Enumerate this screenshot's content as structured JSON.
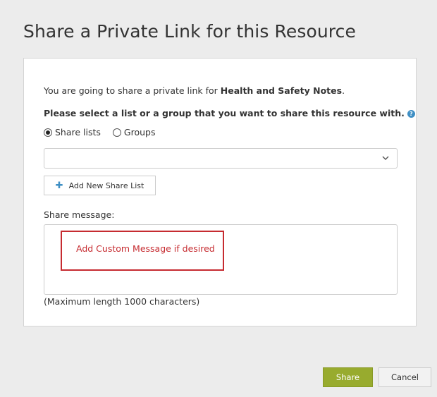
{
  "dialog": {
    "title": "Share a Private Link for this Resource"
  },
  "intro": {
    "prefix": "You are going to share a private link for ",
    "resource_name": "Health and Safety Notes",
    "suffix": "."
  },
  "select_prompt": "Please select a list or a group that you want to share this resource with.",
  "help_icon": {
    "glyph": "?",
    "icon": "question-circle-icon"
  },
  "radio_options": [
    {
      "label": "Share lists",
      "selected": true
    },
    {
      "label": "Groups",
      "selected": false
    }
  ],
  "share_list_select": {
    "value": "",
    "icon": "chevron-down-icon"
  },
  "add_share_list": {
    "label": "Add New Share List",
    "icon": "plus-icon",
    "glyph": "✚"
  },
  "share_message": {
    "label": "Share message:",
    "value": "",
    "max_length_note": "(Maximum length 1000 characters)"
  },
  "annotation": {
    "text": "Add Custom Message if desired",
    "color": "#c62b30"
  },
  "footer": {
    "share_label": "Share",
    "cancel_label": "Cancel"
  },
  "colors": {
    "primary": "#98ab2e",
    "help_icon": "#3f8fc4",
    "background": "#ececec"
  }
}
